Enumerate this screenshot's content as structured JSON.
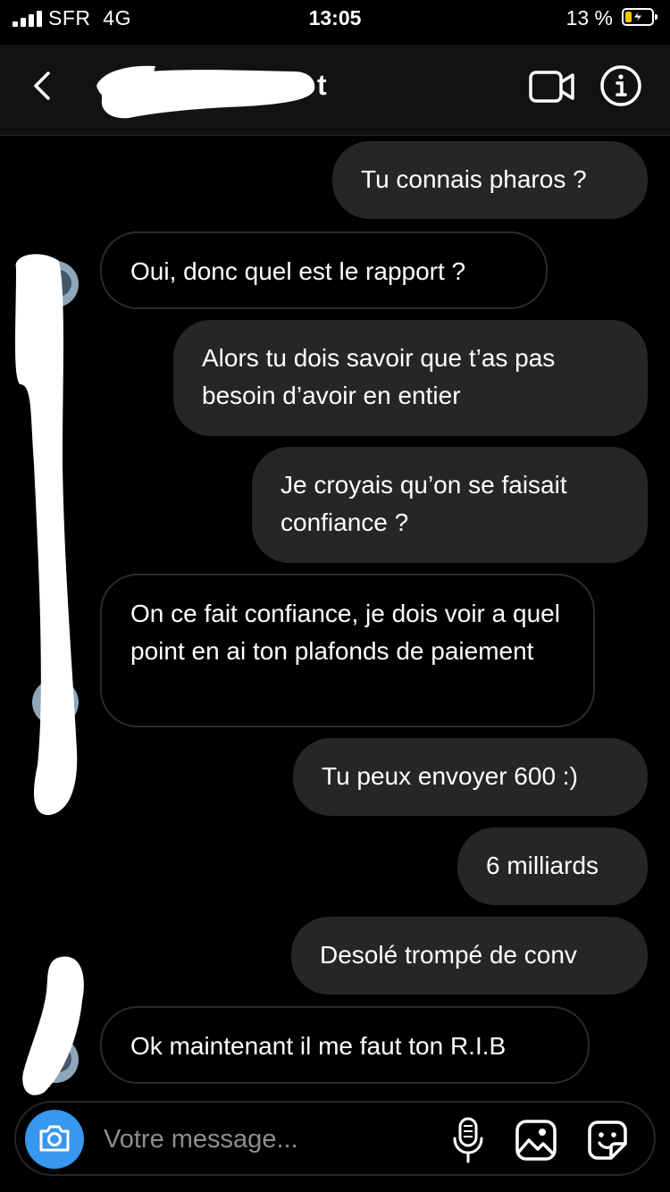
{
  "status_bar": {
    "carrier": "SFR",
    "network": "4G",
    "time": "13:05",
    "battery_percent": "13 %",
    "battery_level": 0.13,
    "battery_color": "#f5c400"
  },
  "header": {
    "contact_name_visible": "t",
    "icons": [
      "back-chevron-icon",
      "video-call-icon",
      "info-icon"
    ]
  },
  "messages": [
    {
      "from": "me",
      "text": "Tu connais pharos ?"
    },
    {
      "from": "them",
      "text": "Oui, donc quel est le rapport ?"
    },
    {
      "from": "me",
      "text": "Alors tu dois savoir que t’as pas besoin d’avoir en entier"
    },
    {
      "from": "me",
      "text": "Je croyais qu’on se faisait confiance ?"
    },
    {
      "from": "them",
      "text": "On ce fait confiance, je dois voir a quel point en ai ton plafonds de paiement"
    },
    {
      "from": "me",
      "text": "Tu peux envoyer 600 :)"
    },
    {
      "from": "me",
      "text": "6 milliards"
    },
    {
      "from": "me",
      "text": "Desolé trompé de conv"
    },
    {
      "from": "them",
      "text": "Ok maintenant il me faut ton R.I.B"
    }
  ],
  "composer": {
    "placeholder": "Votre message...",
    "icons": [
      "camera-icon",
      "microphone-icon",
      "gallery-icon",
      "sticker-icon"
    ],
    "camera_color": "#3897f0"
  },
  "colors": {
    "background": "#000000",
    "outgoing_bubble": "#262626",
    "incoming_border": "#2b2b2b",
    "header": "#121212"
  }
}
